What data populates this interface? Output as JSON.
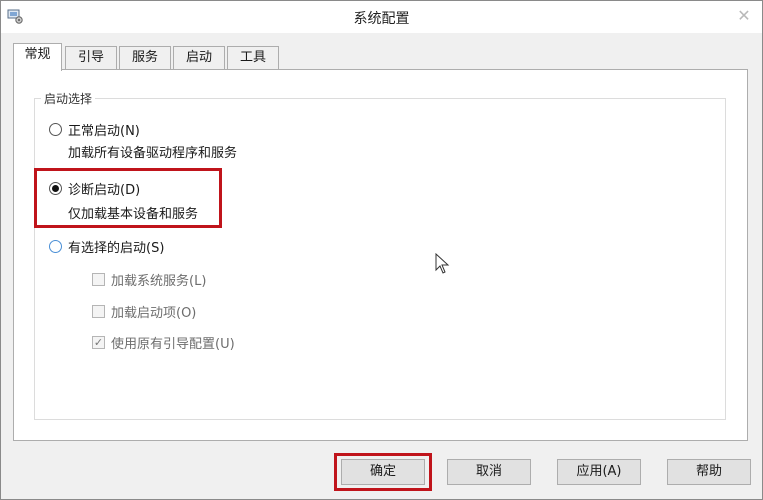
{
  "window": {
    "title": "系统配置"
  },
  "tabs": [
    {
      "label": "常规",
      "active": true
    },
    {
      "label": "引导",
      "active": false
    },
    {
      "label": "服务",
      "active": false
    },
    {
      "label": "启动",
      "active": false
    },
    {
      "label": "工具",
      "active": false
    }
  ],
  "startup_selection": {
    "legend": "启动选择",
    "options": [
      {
        "label": "正常启动(N)",
        "description": "加载所有设备驱动程序和服务",
        "selected": false
      },
      {
        "label": "诊断启动(D)",
        "description": "仅加载基本设备和服务",
        "selected": true
      },
      {
        "label": "有选择的启动(S)",
        "selected": false
      }
    ],
    "selective_items": [
      {
        "label": "加载系统服务(L)",
        "checked": false,
        "enabled": false
      },
      {
        "label": "加载启动项(O)",
        "checked": false,
        "enabled": false
      },
      {
        "label": "使用原有引导配置(U)",
        "checked": true,
        "enabled": false
      }
    ]
  },
  "buttons": {
    "ok": "确定",
    "cancel": "取消",
    "apply": "应用(A)",
    "help": "帮助"
  },
  "colors": {
    "highlight": "#c0141b",
    "panel": "#ffffff",
    "window": "#f0f0f0"
  }
}
